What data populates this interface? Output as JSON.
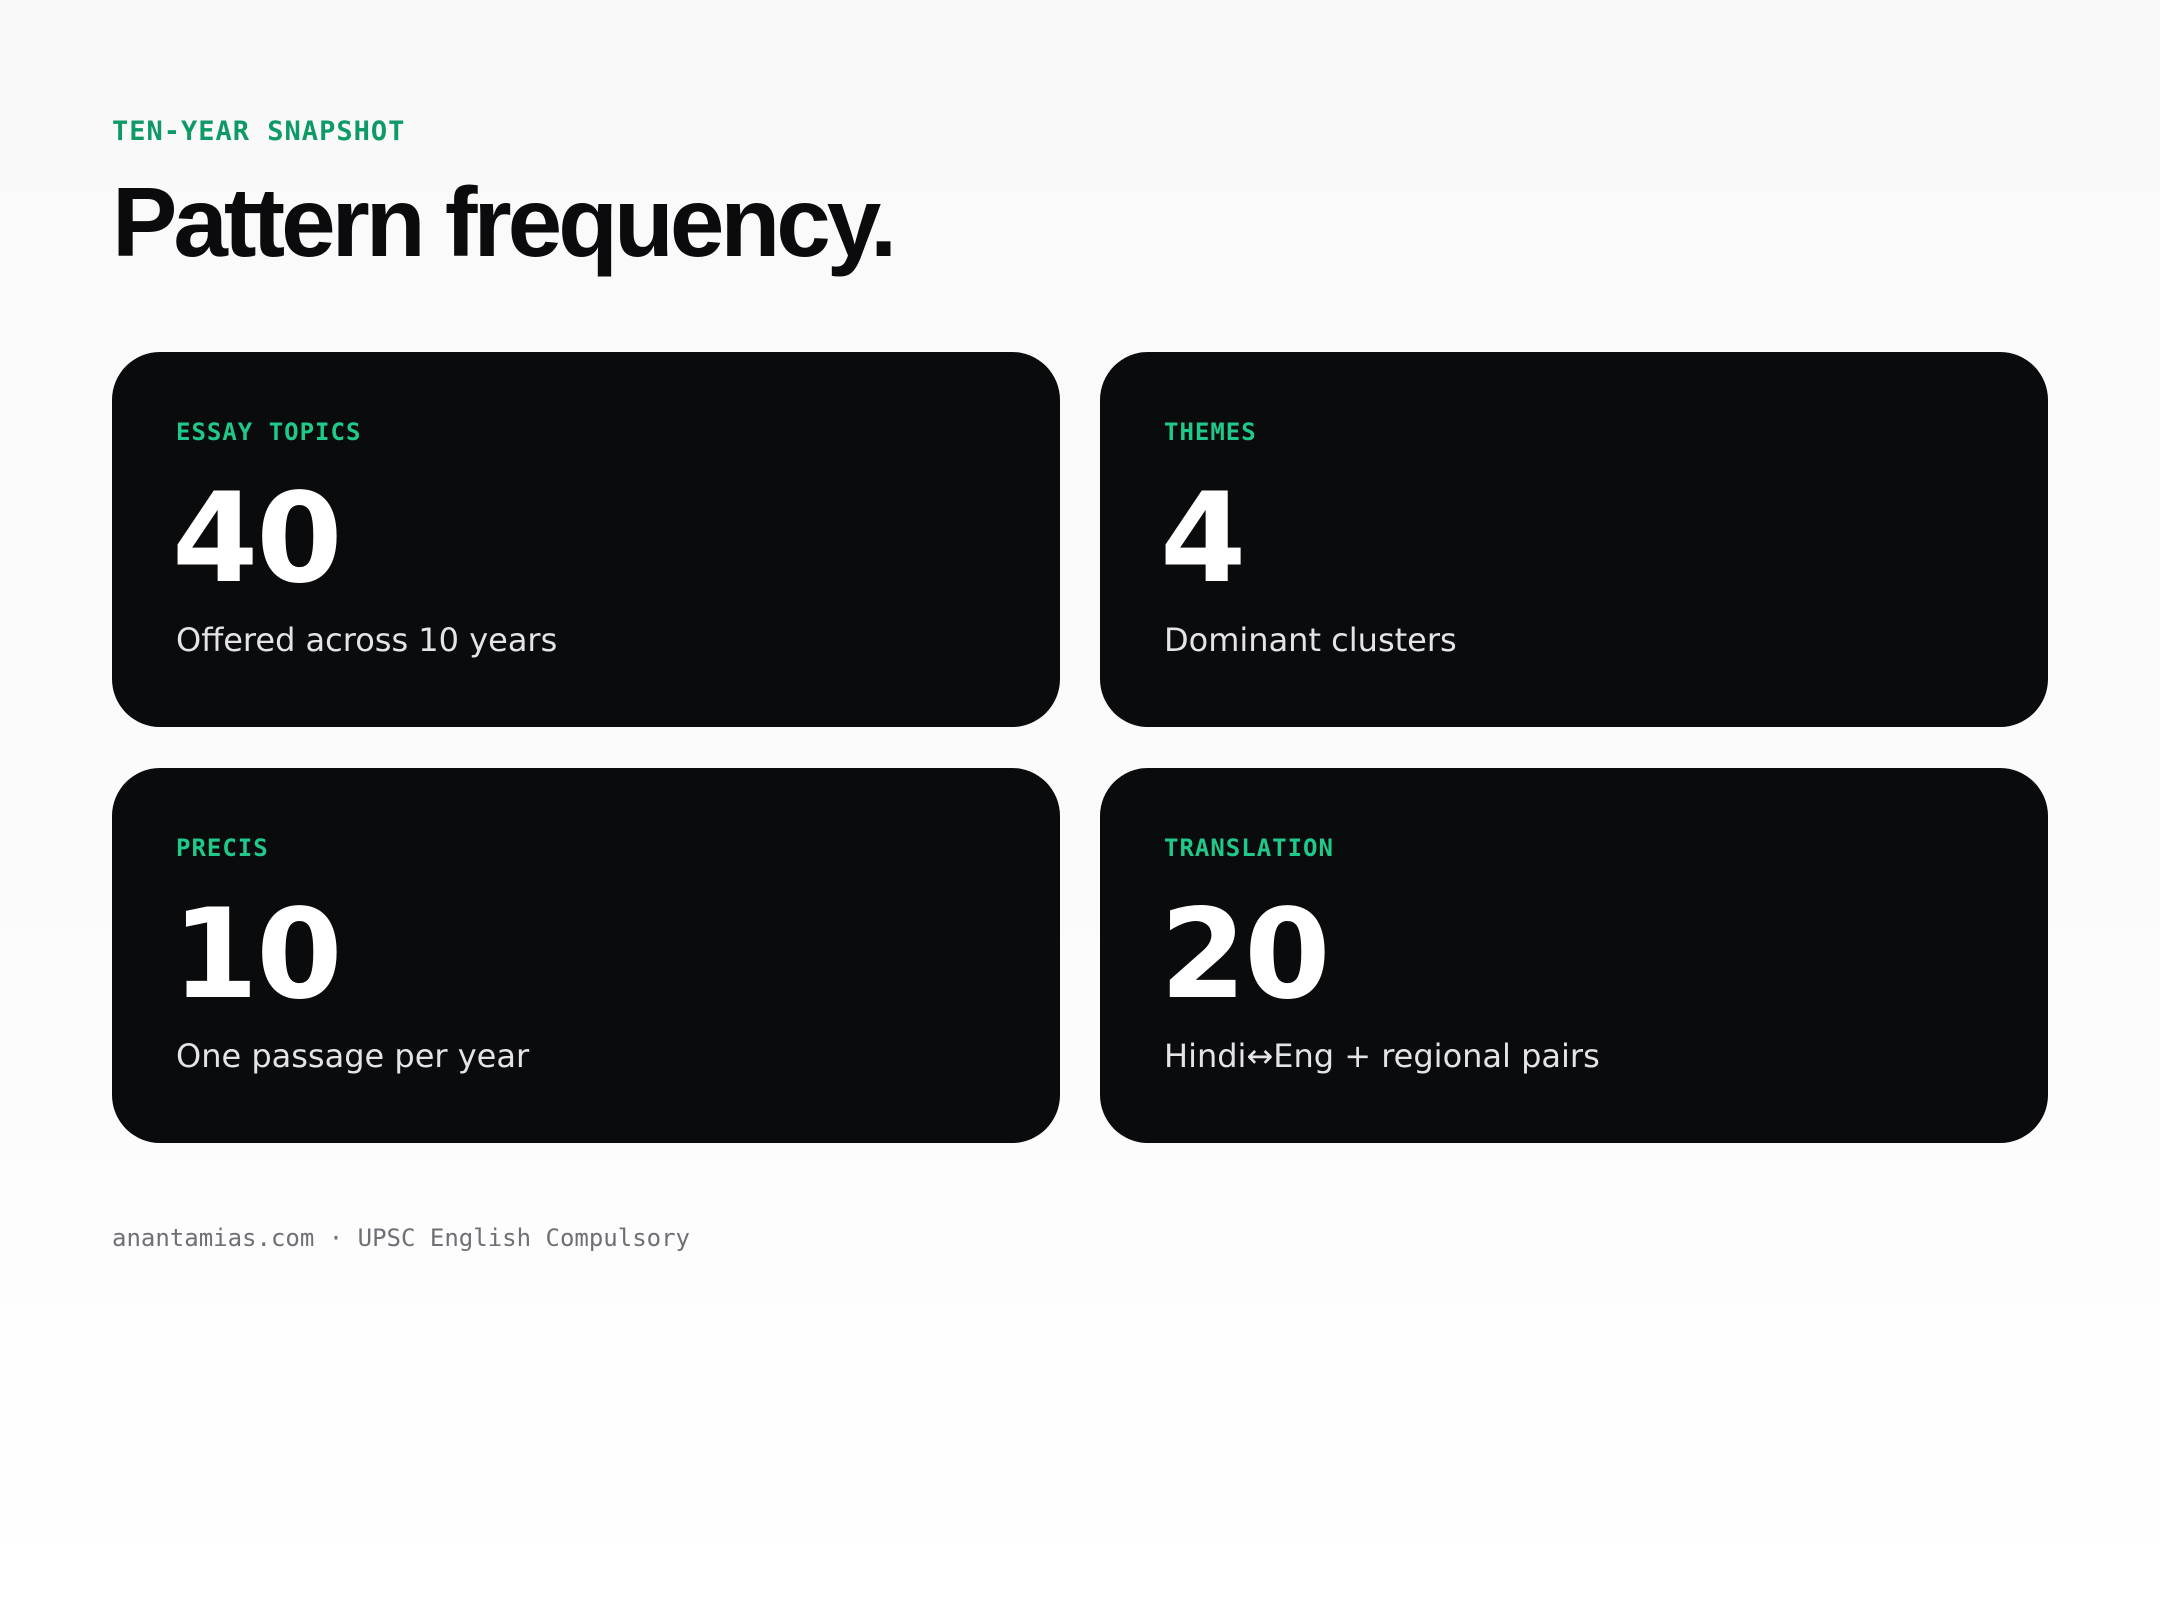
{
  "header": {
    "eyebrow": "TEN-YEAR SNAPSHOT",
    "title": "Pattern frequency."
  },
  "cards": [
    {
      "label": "ESSAY TOPICS",
      "value": "40",
      "description": "Offered across 10 years"
    },
    {
      "label": "THEMES",
      "value": "4",
      "description": "Dominant clusters"
    },
    {
      "label": "PRECIS",
      "value": "10",
      "description": "One passage per year"
    },
    {
      "label": "TRANSLATION",
      "value": "20",
      "description": "Hindi↔Eng + regional pairs"
    }
  ],
  "footer": {
    "site": "anantamias.com",
    "separator": " · ",
    "subject": "UPSC English Compulsory"
  },
  "colors": {
    "accent": "#1fc98a",
    "eyebrow": "#0e9a65",
    "card_background": "#0a0b0d",
    "page_background": "#f9f9f9"
  }
}
